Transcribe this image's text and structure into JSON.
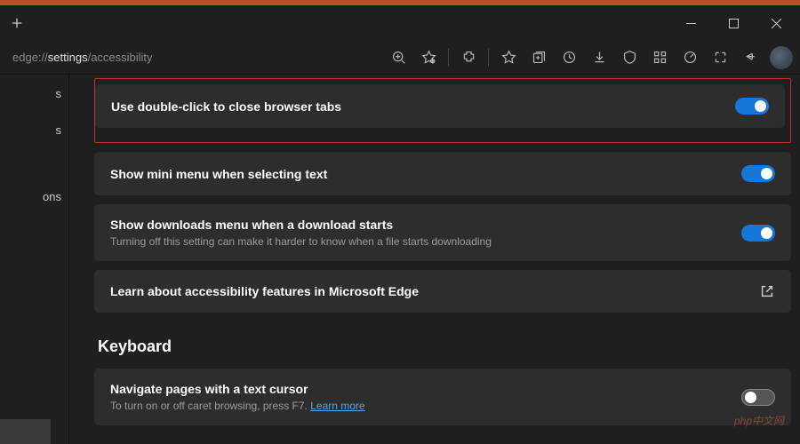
{
  "addressbar": {
    "prefix": "edge://",
    "bold": "settings",
    "suffix": "/accessibility"
  },
  "sidebar": {
    "items": [
      "s",
      "s",
      "ons"
    ]
  },
  "main": {
    "items": [
      {
        "title": "Use double-click to close browser tabs",
        "desc": "",
        "toggle": "on",
        "highlight": true
      },
      {
        "title": "Show mini menu when selecting text",
        "desc": "",
        "toggle": "on"
      },
      {
        "title": "Show downloads menu when a download starts",
        "desc": "Turning off this setting can make it harder to know when a file starts downloading",
        "toggle": "on"
      },
      {
        "title": "Learn about accessibility features in Microsoft Edge",
        "desc": "",
        "external": true
      }
    ],
    "section_heading": "Keyboard",
    "keyboard_items": [
      {
        "title": "Navigate pages with a text cursor",
        "desc_prefix": "To turn on or off caret browsing, press F7. ",
        "link": "Learn more",
        "toggle": "off"
      }
    ]
  },
  "watermark": "php中文网"
}
